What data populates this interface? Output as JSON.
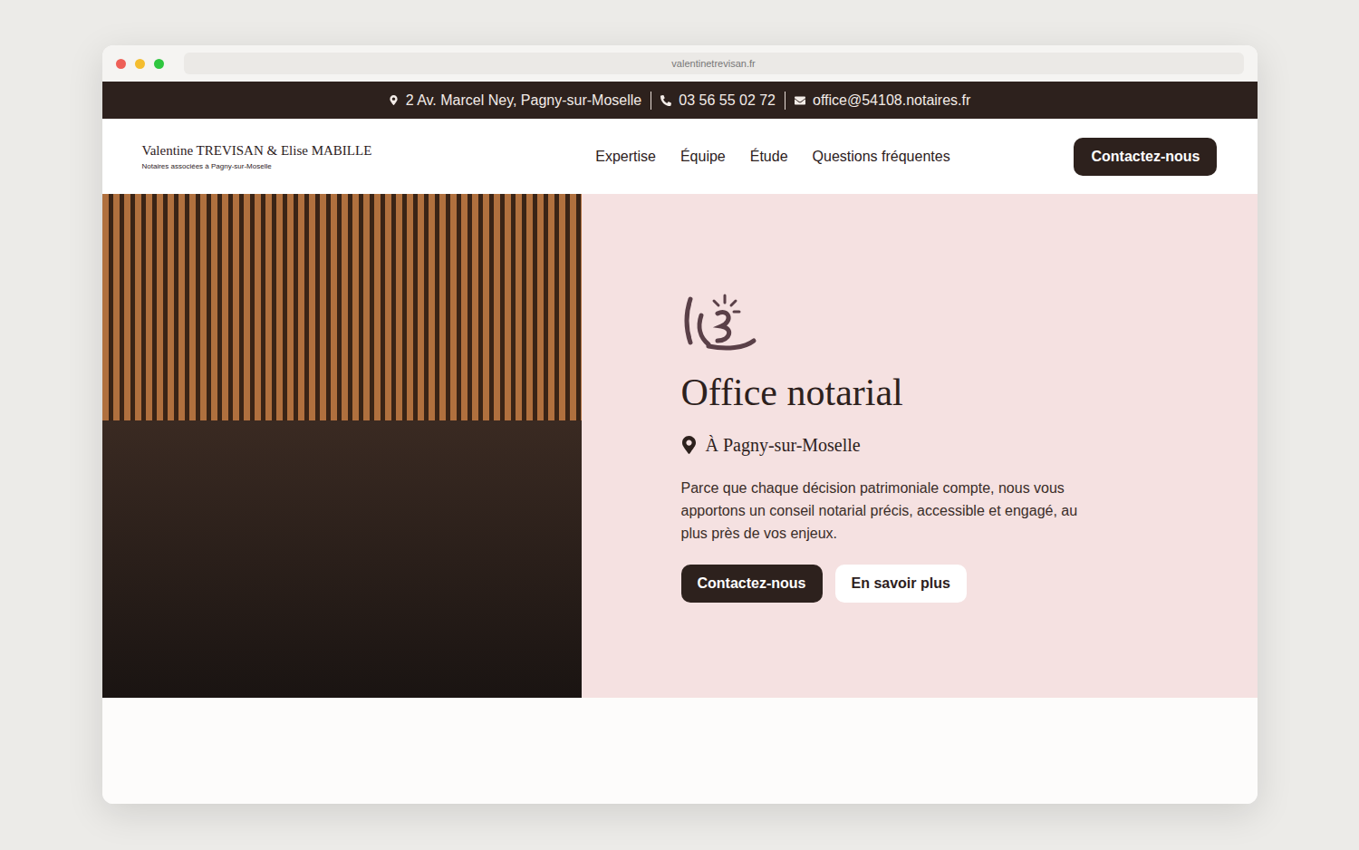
{
  "browser": {
    "url": "valentinetrevisan.fr"
  },
  "topbar": {
    "address": "2 Av. Marcel Ney, Pagny-sur-Moselle",
    "phone": "03 56 55 02 72",
    "email": "office@54108.notaires.fr"
  },
  "brand": {
    "name": "Valentine TREVISAN & Elise MABILLE",
    "tagline": "Notaires associées à Pagny-sur-Moselle"
  },
  "nav": [
    {
      "label": "Expertise"
    },
    {
      "label": "Équipe"
    },
    {
      "label": "Étude"
    },
    {
      "label": "Questions fréquentes"
    }
  ],
  "header_button": "Contactez-nous",
  "hero": {
    "title": "Office notarial",
    "location": "À Pagny-sur-Moselle",
    "text": "Parce que chaque décision patrimoniale compte, nous vous apportons un conseil notarial précis, accessible et engagé, au plus près de vos enjeux.",
    "buttons": [
      {
        "label": "Contactez-nous",
        "primary": true
      },
      {
        "label": "En savoir plus",
        "primary": false
      }
    ]
  }
}
